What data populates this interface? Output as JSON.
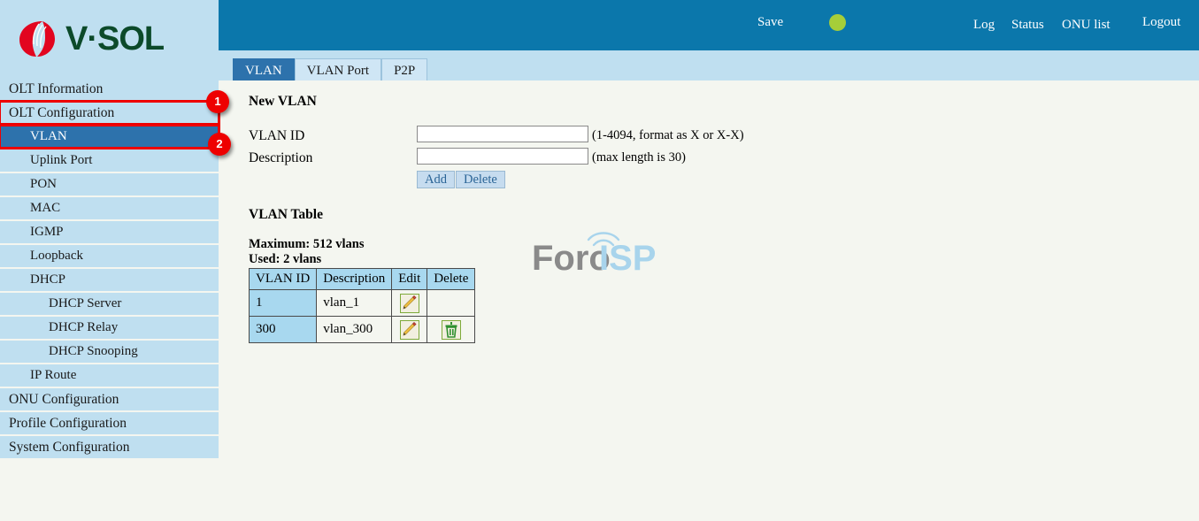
{
  "brand": {
    "name": "V·SOL",
    "logo_icon": "vsol-swirl-logo",
    "logo_red": "#e2051f",
    "logo_green": "#0c4a2a"
  },
  "header": {
    "background": "#0b77ab",
    "save_label": "Save",
    "save_indicator_icon": "green-status-dot",
    "save_indicator_color": "#a6ce39",
    "links": [
      {
        "label": "Log"
      },
      {
        "label": "Status"
      },
      {
        "label": "ONU list"
      },
      {
        "label": "Logout"
      }
    ]
  },
  "tabs": [
    {
      "label": "VLAN",
      "active": true
    },
    {
      "label": "VLAN Port",
      "active": false
    },
    {
      "label": "P2P",
      "active": false
    }
  ],
  "sidebar": {
    "items": [
      {
        "label": "OLT Information",
        "level": 0,
        "selected": false,
        "highlighted": false
      },
      {
        "label": "OLT Configuration",
        "level": 0,
        "selected": false,
        "highlighted": true
      },
      {
        "label": "VLAN",
        "level": 1,
        "selected": true,
        "highlighted": true
      },
      {
        "label": "Uplink Port",
        "level": 1,
        "selected": false,
        "highlighted": false
      },
      {
        "label": "PON",
        "level": 1,
        "selected": false,
        "highlighted": false
      },
      {
        "label": "MAC",
        "level": 1,
        "selected": false,
        "highlighted": false
      },
      {
        "label": "IGMP",
        "level": 1,
        "selected": false,
        "highlighted": false
      },
      {
        "label": "Loopback",
        "level": 1,
        "selected": false,
        "highlighted": false
      },
      {
        "label": "DHCP",
        "level": 1,
        "selected": false,
        "highlighted": false
      },
      {
        "label": "DHCP Server",
        "level": 2,
        "selected": false,
        "highlighted": false
      },
      {
        "label": "DHCP Relay",
        "level": 2,
        "selected": false,
        "highlighted": false
      },
      {
        "label": "DHCP Snooping",
        "level": 2,
        "selected": false,
        "highlighted": false
      },
      {
        "label": "IP Route",
        "level": 1,
        "selected": false,
        "highlighted": false
      },
      {
        "label": "ONU Configuration",
        "level": 0,
        "selected": false,
        "highlighted": false
      },
      {
        "label": "Profile Configuration",
        "level": 0,
        "selected": false,
        "highlighted": false
      },
      {
        "label": "System Configuration",
        "level": 0,
        "selected": false,
        "highlighted": false
      }
    ]
  },
  "annotations": [
    {
      "number": "1",
      "target": "OLT Configuration"
    },
    {
      "number": "2",
      "target": "VLAN"
    }
  ],
  "main": {
    "new_vlan": {
      "title": "New VLAN",
      "vlan_id_label": "VLAN ID",
      "vlan_id_value": "",
      "vlan_id_hint": "(1-4094, format as X or X-X)",
      "description_label": "Description",
      "description_value": "",
      "description_hint": "(max length is 30)",
      "add_label": "Add",
      "delete_label": "Delete"
    },
    "vlan_table": {
      "title": "VLAN Table",
      "maximum_text": "Maximum: 512 vlans",
      "used_text": "Used: 2 vlans",
      "columns": [
        "VLAN ID",
        "Description",
        "Edit",
        "Delete"
      ],
      "rows": [
        {
          "vlan_id": "1",
          "description": "vlan_1",
          "edit_icon": "pencil-edit-icon",
          "delete_icon": ""
        },
        {
          "vlan_id": "300",
          "description": "vlan_300",
          "edit_icon": "pencil-edit-icon",
          "delete_icon": "trash-delete-icon"
        }
      ]
    }
  },
  "watermark": {
    "text_primary": "Foro",
    "text_secondary": "ISP",
    "primary_color": "#8a8a8a",
    "secondary_color": "#a8d4ec",
    "icon": "wifi-signal-icon"
  }
}
